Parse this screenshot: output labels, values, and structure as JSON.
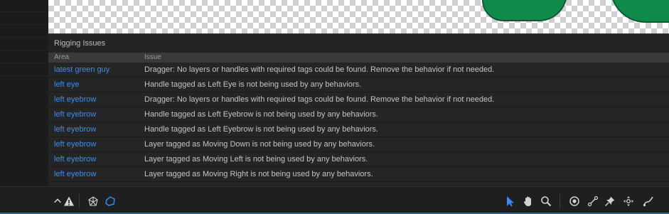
{
  "panel": {
    "title": "Rigging Issues",
    "columns": {
      "area": "Area",
      "issue": "Issue"
    },
    "rows": [
      {
        "area": "latest green guy",
        "issue": "Dragger: No layers or handles with required tags could be found. Remove the behavior if not needed."
      },
      {
        "area": "left eye",
        "issue": "Handle tagged as Left Eye is not being used by any behaviors."
      },
      {
        "area": "left eyebrow",
        "issue": "Dragger: No layers or handles with required tags could be found. Remove the behavior if not needed."
      },
      {
        "area": "left eyebrow",
        "issue": "Handle tagged as Left Eyebrow is not being used by any behaviors."
      },
      {
        "area": "left eyebrow",
        "issue": "Handle tagged as Left Eyebrow is not being used by any behaviors."
      },
      {
        "area": "left eyebrow",
        "issue": "Layer tagged as Moving Down is not being used by any behaviors."
      },
      {
        "area": "left eyebrow",
        "issue": "Layer tagged as Moving Left is not being used by any behaviors."
      },
      {
        "area": "left eyebrow",
        "issue": "Layer tagged as Moving Right is not being used by any behaviors."
      }
    ]
  },
  "toolbar": {
    "left_tools": [
      "chevron-up-icon",
      "warning-icon",
      "mesh-icon",
      "polygon-icon"
    ],
    "right_tools": [
      "select-arrow-icon",
      "hand-icon",
      "zoom-icon",
      "origin-icon",
      "stick-icon",
      "pin-icon",
      "dragger-icon",
      "draw-icon"
    ]
  },
  "colors": {
    "area_link": "#3d8ee8",
    "accent": "#3a87ef",
    "figure": "#0f8a4a"
  }
}
